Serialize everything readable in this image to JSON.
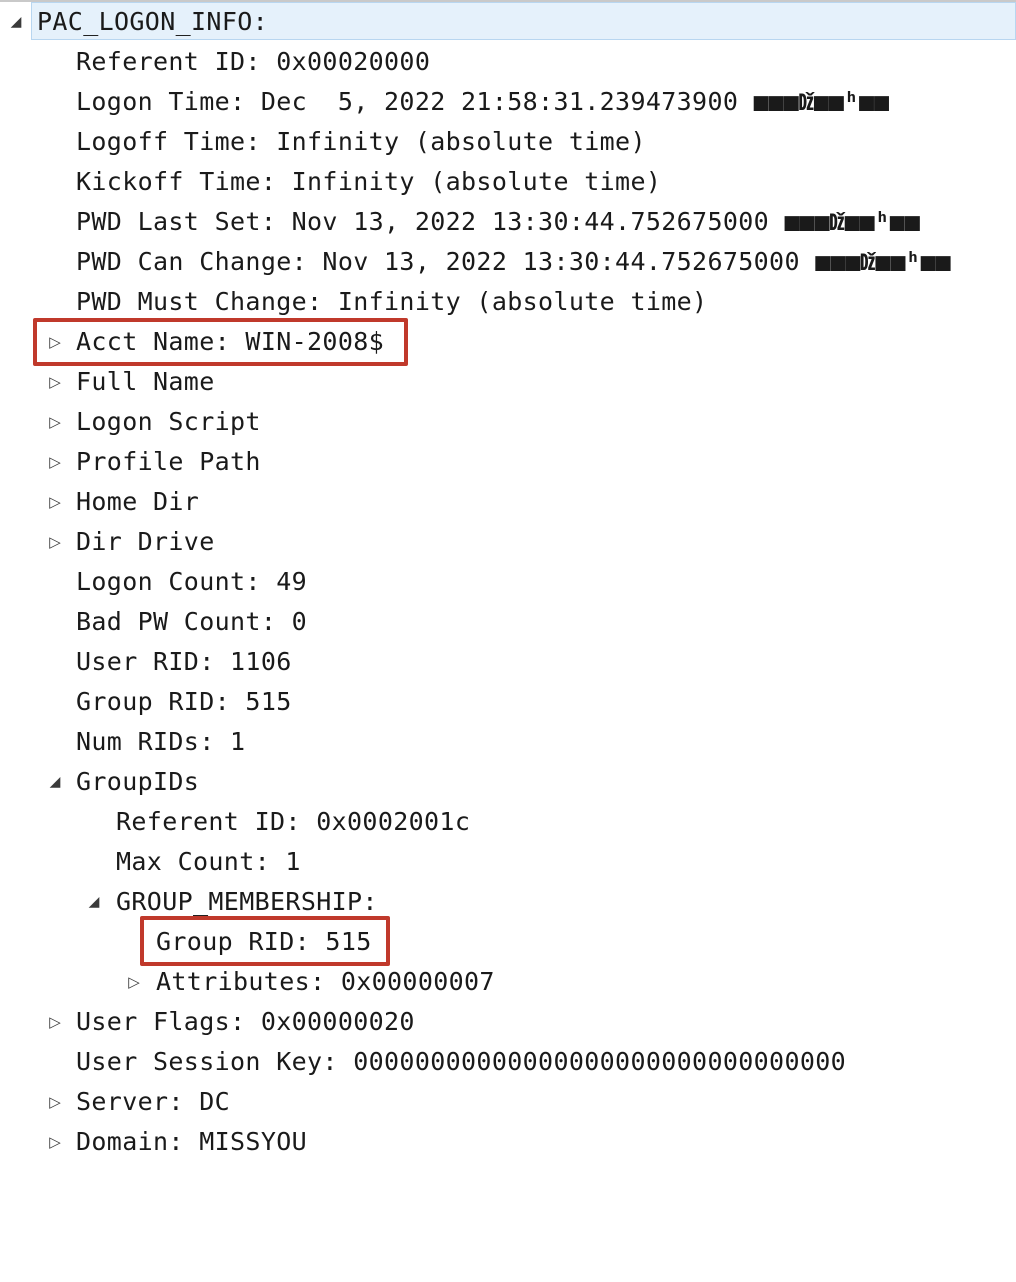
{
  "tree": {
    "root": {
      "label": "PAC_LOGON_INFO:",
      "expanded": true
    },
    "referent_id": "Referent ID: 0x00020000",
    "logon_time": "Logon Time: Dec  5, 2022 21:58:31.239473900",
    "logon_time_suffix": "■■■ǅ■■ʰ■■",
    "logoff_time": "Logoff Time: Infinity (absolute time)",
    "kickoff_time": "Kickoff Time: Infinity (absolute time)",
    "pwd_last_set": "PWD Last Set: Nov 13, 2022 13:30:44.752675000",
    "pwd_last_set_suffix": "■■■ǅ■■ʰ■■",
    "pwd_can_change": "PWD Can Change: Nov 13, 2022 13:30:44.752675000",
    "pwd_can_change_suffix": "■■■ǅ■■ʰ■■",
    "pwd_must_change": "PWD Must Change: Infinity (absolute time)",
    "acct_name": "Acct Name: WIN-2008$",
    "full_name": "Full Name",
    "logon_script": "Logon Script",
    "profile_path": "Profile Path",
    "home_dir": "Home Dir",
    "dir_drive": "Dir Drive",
    "logon_count": "Logon Count: 49",
    "bad_pw_count": "Bad PW Count: 0",
    "user_rid": "User RID: 1106",
    "group_rid": "Group RID: 515",
    "num_rids": "Num RIDs: 1",
    "group_ids": {
      "label": "GroupIDs",
      "referent_id": "Referent ID: 0x0002001c",
      "max_count": "Max Count: 1",
      "group_membership": {
        "label": "GROUP_MEMBERSHIP:",
        "group_rid": "Group RID: 515",
        "attributes": "Attributes: 0x00000007"
      }
    },
    "user_flags": "User Flags: 0x00000020",
    "user_session_key": "User Session Key: 00000000000000000000000000000000",
    "server": "Server: DC",
    "domain": "Domain: MISSYOU"
  },
  "glyphs": {
    "expanded": "◢",
    "collapsed": "▷"
  },
  "highlight_color": "#c0392b",
  "selection_color": "#e5f1fb"
}
